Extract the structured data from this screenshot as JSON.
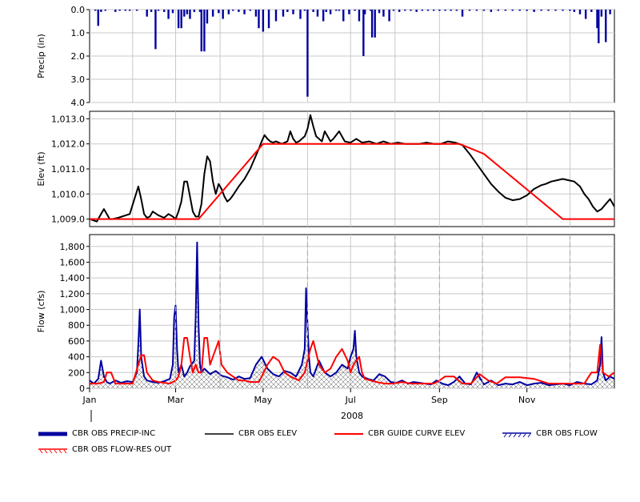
{
  "chart_data": [
    {
      "type": "bar",
      "panel": "precip",
      "ylabel": "Precip (in)",
      "ylim": [
        0.0,
        4.0
      ],
      "y_inverted": true,
      "yticks": [
        "0.0",
        "1.0",
        "2.0",
        "3.0",
        "4.0"
      ],
      "ytick_values": [
        0,
        1,
        2,
        3,
        4
      ],
      "grid": true,
      "series": [
        {
          "name": "CBR OBS PRECIP-INC",
          "color": "#0000a0",
          "x": [
            4,
            6,
            8,
            11,
            18,
            21,
            25,
            28,
            33,
            40,
            43,
            46,
            48,
            52,
            55,
            58,
            62,
            64,
            66,
            68,
            70,
            73,
            77,
            80,
            82,
            86,
            90,
            93,
            97,
            100,
            104,
            108,
            112,
            116,
            118,
            121,
            125,
            130,
            135,
            138,
            142,
            147,
            150,
            152,
            156,
            159,
            163,
            165,
            168,
            172,
            174,
            177,
            181,
            185,
            188,
            192,
            196,
            199,
            202,
            205,
            209,
            212,
            216,
            220,
            224,
            228,
            232,
            236,
            240,
            244,
            248,
            252,
            256,
            260,
            265,
            270,
            275,
            280,
            285,
            290,
            295,
            300,
            305,
            310,
            315,
            320,
            325,
            330,
            335,
            338,
            342,
            346,
            350,
            354,
            357,
            360,
            363
          ],
          "values": [
            0.05,
            0.7,
            0.1,
            0.05,
            0.1,
            0.05,
            0.05,
            0.05,
            0.05,
            0.3,
            0.1,
            1.7,
            0.05,
            0.1,
            0.4,
            0.15,
            0.8,
            0.8,
            0.3,
            0.2,
            0.4,
            0.1,
            0.1,
            1.8,
            0.6,
            0.3,
            0.15,
            0.4,
            0.2,
            0.05,
            0.1,
            0.2,
            0.05,
            0.3,
            0.8,
            0.95,
            0.8,
            0.5,
            0.3,
            0.1,
            0.2,
            0.4,
            0.05,
            0.05,
            0.1,
            0.3,
            0.5,
            0.1,
            0.2,
            0.05,
            0.05,
            0.5,
            0.2,
            0.05,
            0.5,
            0.2,
            0.05,
            1.2,
            0.15,
            0.3,
            0.5,
            0.05,
            0.1,
            0.05,
            0.05,
            0.1,
            0.05,
            0.05,
            0.05,
            0.05,
            0.05,
            0.05,
            0.05,
            0.3,
            0.05,
            0.05,
            0.05,
            0.1,
            0.05,
            0.05,
            0.05,
            0.05,
            0.05,
            0.1,
            0.05,
            0.05,
            0.05,
            0.05,
            0.05,
            0.1,
            0.2,
            0.4,
            0.1,
            0.8,
            0.3,
            1.4,
            0.2
          ],
          "spikes": [
            {
              "x": 152,
              "value": 3.75
            },
            {
              "x": 191,
              "value": 2.0
            },
            {
              "x": 197,
              "value": 1.2
            },
            {
              "x": 78,
              "value": 1.8
            },
            {
              "x": 355,
              "value": 1.45
            }
          ]
        }
      ]
    },
    {
      "type": "line",
      "panel": "elev",
      "ylabel": "Elev (ft)",
      "ylim": [
        1008.7,
        1013.3
      ],
      "yticks": [
        "1,009.0",
        "1,010.0",
        "1,011.0",
        "1,012.0",
        "1,013.0"
      ],
      "ytick_values": [
        1009,
        1010,
        1011,
        1012,
        1013
      ],
      "grid": true,
      "series": [
        {
          "name": "CBR OBS ELEV",
          "color": "#000000",
          "x": [
            0,
            5,
            8,
            10,
            12,
            14,
            16,
            20,
            28,
            34,
            36,
            38,
            40,
            42,
            44,
            48,
            52,
            55,
            58,
            60,
            62,
            64,
            66,
            68,
            70,
            72,
            74,
            76,
            78,
            80,
            82,
            84,
            86,
            88,
            90,
            92,
            94,
            96,
            98,
            100,
            104,
            108,
            112,
            115,
            118,
            120,
            122,
            124,
            126,
            128,
            130,
            134,
            138,
            140,
            142,
            144,
            146,
            148,
            150,
            152,
            154,
            156,
            158,
            160,
            162,
            164,
            166,
            168,
            170,
            174,
            178,
            182,
            186,
            190,
            195,
            200,
            205,
            210,
            215,
            220,
            225,
            230,
            235,
            240,
            245,
            250,
            255,
            260,
            265,
            270,
            275,
            280,
            285,
            290,
            295,
            300,
            305,
            310,
            315,
            318,
            322,
            326,
            330,
            334,
            338,
            342,
            345,
            348,
            351,
            354,
            357,
            360,
            363,
            366
          ],
          "values": [
            1009.0,
            1008.9,
            1009.2,
            1009.4,
            1009.2,
            1009.0,
            1009.0,
            1009.05,
            1009.2,
            1010.3,
            1009.8,
            1009.2,
            1009.05,
            1009.1,
            1009.3,
            1009.15,
            1009.05,
            1009.2,
            1009.1,
            1009.0,
            1009.3,
            1009.7,
            1010.5,
            1010.5,
            1009.9,
            1009.3,
            1009.1,
            1009.1,
            1009.6,
            1010.8,
            1011.5,
            1011.3,
            1010.5,
            1010.0,
            1010.4,
            1010.2,
            1009.9,
            1009.7,
            1009.8,
            1009.95,
            1010.3,
            1010.6,
            1011.0,
            1011.4,
            1011.8,
            1012.1,
            1012.35,
            1012.2,
            1012.1,
            1012.05,
            1012.1,
            1012.0,
            1012.1,
            1012.5,
            1012.2,
            1012.05,
            1012.1,
            1012.2,
            1012.3,
            1012.6,
            1013.15,
            1012.7,
            1012.3,
            1012.2,
            1012.1,
            1012.5,
            1012.3,
            1012.1,
            1012.2,
            1012.5,
            1012.1,
            1012.05,
            1012.2,
            1012.05,
            1012.1,
            1012.0,
            1012.1,
            1012.0,
            1012.05,
            1012.0,
            1012.0,
            1012.0,
            1012.05,
            1012.0,
            1012.0,
            1012.1,
            1012.05,
            1011.95,
            1011.6,
            1011.2,
            1010.8,
            1010.4,
            1010.1,
            1009.85,
            1009.75,
            1009.8,
            1009.95,
            1010.2,
            1010.35,
            1010.4,
            1010.5,
            1010.55,
            1010.6,
            1010.55,
            1010.5,
            1010.3,
            1010.0,
            1009.8,
            1009.5,
            1009.3,
            1009.4,
            1009.6,
            1009.8,
            1009.5
          ]
        },
        {
          "name": "CBR GUIDE CURVE ELEV",
          "color": "#ff0000",
          "x": [
            0,
            5,
            76,
            121,
            258,
            275,
            330,
            366
          ],
          "values": [
            1009.0,
            1009.0,
            1009.0,
            1012.0,
            1012.0,
            1011.6,
            1009.0,
            1009.0
          ]
        }
      ]
    },
    {
      "type": "line",
      "panel": "flow",
      "ylabel": "Flow (cfs)",
      "ylim": [
        0,
        1950
      ],
      "yticks": [
        "0",
        "200",
        "400",
        "600",
        "800",
        "1,000",
        "1,200",
        "1,400",
        "1,600",
        "1,800"
      ],
      "ytick_values": [
        0,
        200,
        400,
        600,
        800,
        1000,
        1200,
        1400,
        1600,
        1800
      ],
      "xticks": [
        "Jan",
        "Mar",
        "May",
        "Jul",
        "Sep",
        "Nov"
      ],
      "xtick_days": [
        0,
        60,
        121,
        182,
        244,
        305
      ],
      "year_label": "2008",
      "grid": true,
      "series": [
        {
          "name": "CBR OBS FLOW",
          "color": "#0000a0",
          "x": [
            0,
            3,
            6,
            8,
            10,
            12,
            14,
            18,
            22,
            26,
            30,
            33,
            34,
            35,
            36,
            38,
            40,
            44,
            48,
            52,
            56,
            58,
            59,
            60,
            61,
            62,
            64,
            66,
            68,
            70,
            73,
            74,
            75,
            76,
            77,
            78,
            80,
            84,
            88,
            92,
            96,
            100,
            104,
            108,
            112,
            116,
            120,
            124,
            128,
            132,
            136,
            140,
            144,
            148,
            150,
            151,
            152,
            153,
            154,
            156,
            160,
            164,
            168,
            172,
            176,
            180,
            182,
            184,
            185,
            186,
            188,
            190,
            194,
            198,
            202,
            206,
            210,
            214,
            218,
            222,
            226,
            230,
            234,
            238,
            242,
            246,
            250,
            254,
            258,
            262,
            266,
            270,
            275,
            280,
            285,
            290,
            295,
            300,
            305,
            310,
            315,
            320,
            325,
            330,
            335,
            340,
            345,
            350,
            354,
            356,
            357,
            358,
            360,
            363,
            366
          ],
          "values": [
            100,
            60,
            120,
            350,
            150,
            80,
            60,
            100,
            70,
            90,
            80,
            200,
            550,
            1000,
            400,
            150,
            100,
            80,
            70,
            90,
            120,
            300,
            900,
            1050,
            500,
            200,
            300,
            150,
            200,
            280,
            350,
            900,
            1850,
            800,
            300,
            200,
            250,
            180,
            220,
            160,
            140,
            110,
            150,
            120,
            130,
            300,
            400,
            250,
            180,
            150,
            220,
            200,
            150,
            300,
            500,
            1270,
            800,
            400,
            200,
            150,
            350,
            200,
            150,
            200,
            300,
            250,
            400,
            500,
            730,
            400,
            200,
            150,
            120,
            100,
            180,
            150,
            80,
            70,
            100,
            60,
            80,
            70,
            60,
            50,
            100,
            60,
            40,
            80,
            150,
            60,
            50,
            200,
            50,
            100,
            40,
            60,
            50,
            80,
            40,
            60,
            70,
            40,
            50,
            60,
            40,
            80,
            60,
            50,
            100,
            300,
            650,
            200,
            100,
            150,
            120
          ]
        },
        {
          "name": "CBR OBS FLOW-RES OUT",
          "color": "#ff0000",
          "x": [
            0,
            6,
            10,
            12,
            15,
            18,
            30,
            36,
            38,
            40,
            42,
            44,
            48,
            56,
            60,
            62,
            64,
            66,
            68,
            70,
            72,
            74,
            76,
            78,
            80,
            82,
            84,
            86,
            88,
            90,
            92,
            96,
            100,
            104,
            108,
            112,
            116,
            118,
            120,
            124,
            128,
            132,
            136,
            140,
            146,
            150,
            152,
            154,
            156,
            160,
            164,
            168,
            172,
            176,
            180,
            182,
            184,
            186,
            188,
            190,
            192,
            196,
            200,
            206,
            212,
            218,
            224,
            230,
            236,
            240,
            244,
            248,
            254,
            260,
            266,
            272,
            278,
            284,
            290,
            300,
            310,
            320,
            330,
            340,
            345,
            350,
            352,
            354,
            356,
            358,
            362,
            366
          ],
          "values": [
            60,
            60,
            80,
            200,
            200,
            60,
            60,
            420,
            420,
            200,
            150,
            100,
            80,
            60,
            100,
            150,
            300,
            640,
            640,
            400,
            200,
            300,
            200,
            200,
            640,
            640,
            300,
            400,
            500,
            600,
            300,
            200,
            150,
            100,
            100,
            80,
            80,
            80,
            150,
            300,
            400,
            350,
            200,
            150,
            100,
            200,
            350,
            500,
            600,
            300,
            200,
            250,
            400,
            500,
            350,
            200,
            300,
            350,
            400,
            200,
            120,
            100,
            80,
            60,
            60,
            80,
            60,
            60,
            60,
            60,
            100,
            150,
            150,
            60,
            60,
            180,
            100,
            60,
            140,
            140,
            120,
            60,
            60,
            60,
            60,
            200,
            200,
            200,
            550,
            200,
            150,
            200
          ]
        }
      ]
    }
  ],
  "legend": [
    {
      "label": "CBR OBS PRECIP-INC",
      "style": "thick-line",
      "color": "#0000a0"
    },
    {
      "label": "CBR OBS ELEV",
      "style": "line",
      "color": "#000000"
    },
    {
      "label": "CBR GUIDE CURVE ELEV",
      "style": "line",
      "color": "#ff0000"
    },
    {
      "label": "CBR OBS FLOW",
      "style": "hatched",
      "color": "#0000a0"
    },
    {
      "label": "CBR OBS FLOW-RES OUT",
      "style": "hatched",
      "color": "#ff0000"
    }
  ]
}
